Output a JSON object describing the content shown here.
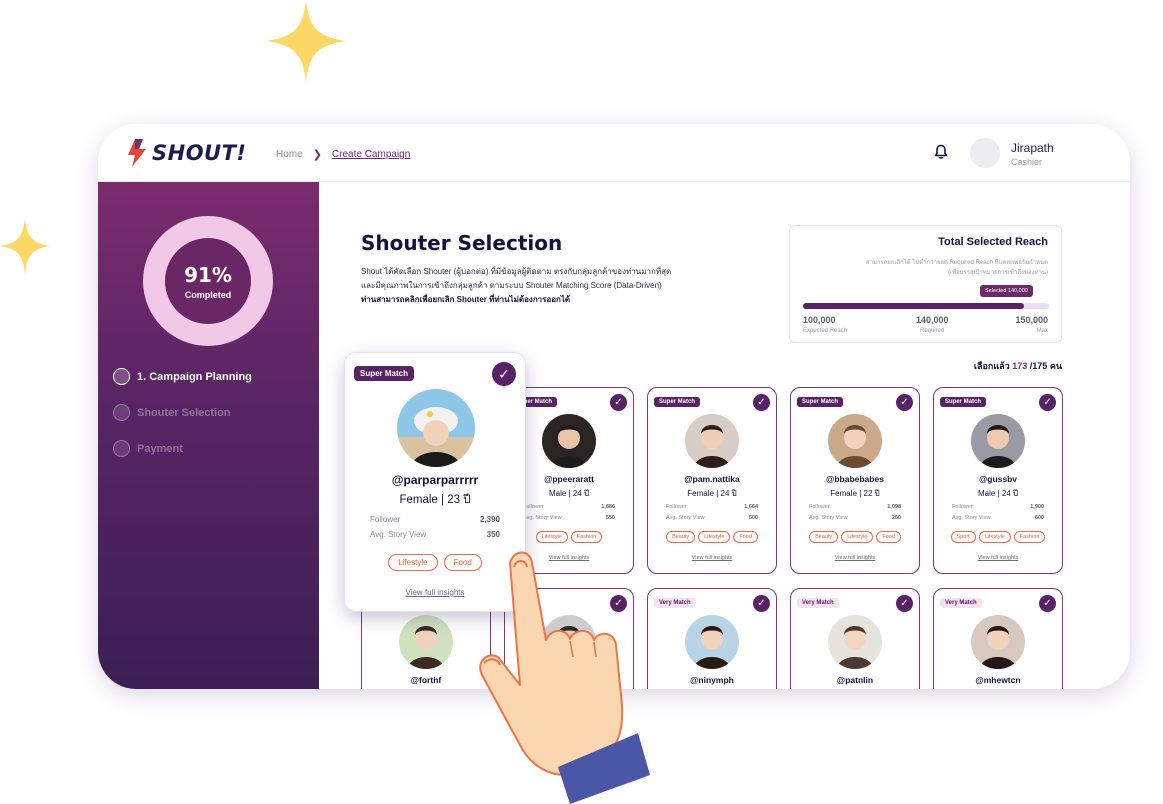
{
  "app": {
    "logo": "SHOUT!",
    "brand_color": "#6b2a6b",
    "accent_color": "#e86a4a"
  },
  "breadcrumb": {
    "home": "Home",
    "current": "Create Campaign"
  },
  "user": {
    "name": "Jirapath",
    "role": "Cashier"
  },
  "progress": {
    "percent_text": "91%",
    "label": "Completed",
    "value": 0.91
  },
  "steps": [
    {
      "label": "1. Campaign Planning",
      "state": "active"
    },
    {
      "label": "Shouter Selection",
      "state": "inactive"
    },
    {
      "label": "Payment",
      "state": "inactive"
    }
  ],
  "page": {
    "title": "Shouter Selection",
    "desc_line1": "Shout ได้คัดเลือก Shouter (ผู้บอกต่อ) ที่มีข้อมูลผู้ติดตาม ตรงกับกลุ่มลูกค้าของท่านมากที่สุด",
    "desc_line2": "และมีคุณภาพในการเข้าถึงกลุ่มลูกค้า ตามระบบ Shouter Matching Score (Data-Driven)",
    "desc_line3": "ท่านสามารถคลิกเพื่อยกเลิก Shouter ที่ท่านไม่ต้องการออกได้"
  },
  "reach": {
    "title": "Total Selected Reach",
    "note_line1": "สามารถยกเลิกได้ ไม่ต่ำกว่ายอด Required Reach ที่แพลตฟอร์มกำหนด",
    "note_line2": "(เพื่อบรรลุเป้าหมายการเข้าถึงของท่าน)",
    "tooltip": "Selected 140,000",
    "fill_fraction": 0.9,
    "min_value": "100,000",
    "min_label": "Expected Reach",
    "req_value": "140,000",
    "req_label": "Required",
    "max_value": "150,000",
    "max_label": "Max"
  },
  "selection": {
    "prefix": "เลือกแล้ว",
    "count": "173",
    "total": "/175 คน"
  },
  "featured": {
    "badge": "Super Match",
    "handle": "@parparparrrrr",
    "gender": "Female | 23 ปี",
    "follower_label": "Follower",
    "follower": "2,390",
    "story_label": "Avg. Story View",
    "story": "350",
    "tags": [
      "Lifestyle",
      "Food"
    ],
    "link": "View full insights"
  },
  "cards_row1": [
    {
      "badge": "Super Match",
      "handle": "@ppeeraratt",
      "gender": "Male | 24 ปี",
      "follower_label": "Follower",
      "follower": "1,886",
      "story_label": "Avg. Story View",
      "story": "550",
      "tags": [
        "Lifestyle",
        "Fashion"
      ],
      "link": "View full insights"
    },
    {
      "badge": "Super Match",
      "handle": "@pam.nattika",
      "gender": "Female | 24 ปี",
      "follower_label": "Follower",
      "follower": "1,664",
      "story_label": "Avg. Story View",
      "story": "500",
      "tags": [
        "Beauty",
        "Lifestyle",
        "Food"
      ],
      "link": "View full insights"
    },
    {
      "badge": "Super Match",
      "handle": "@bbabebabes",
      "gender": "Female | 22 ปี",
      "follower_label": "Follower",
      "follower": "1,098",
      "story_label": "Avg. Story View",
      "story": "250",
      "tags": [
        "Beauty",
        "Lifestyle",
        "Food"
      ],
      "link": "View full insights"
    },
    {
      "badge": "Super Match",
      "handle": "@gussbv",
      "gender": "Male | 24 ปี",
      "follower_label": "Follower",
      "follower": "1,900",
      "story_label": "Avg. Story View",
      "story": "600",
      "tags": [
        "Sport",
        "Lifestyle",
        "Fashion"
      ],
      "link": "View full insights"
    }
  ],
  "cards_row2": [
    {
      "badge": "",
      "handle": "@forthf"
    },
    {
      "badge": "",
      "handle": ""
    },
    {
      "badge": "Very Match",
      "handle": "@ninymph"
    },
    {
      "badge": "Very Match",
      "handle": "@patnlin"
    },
    {
      "badge": "Very Match",
      "handle": "@mhewtcn"
    }
  ]
}
